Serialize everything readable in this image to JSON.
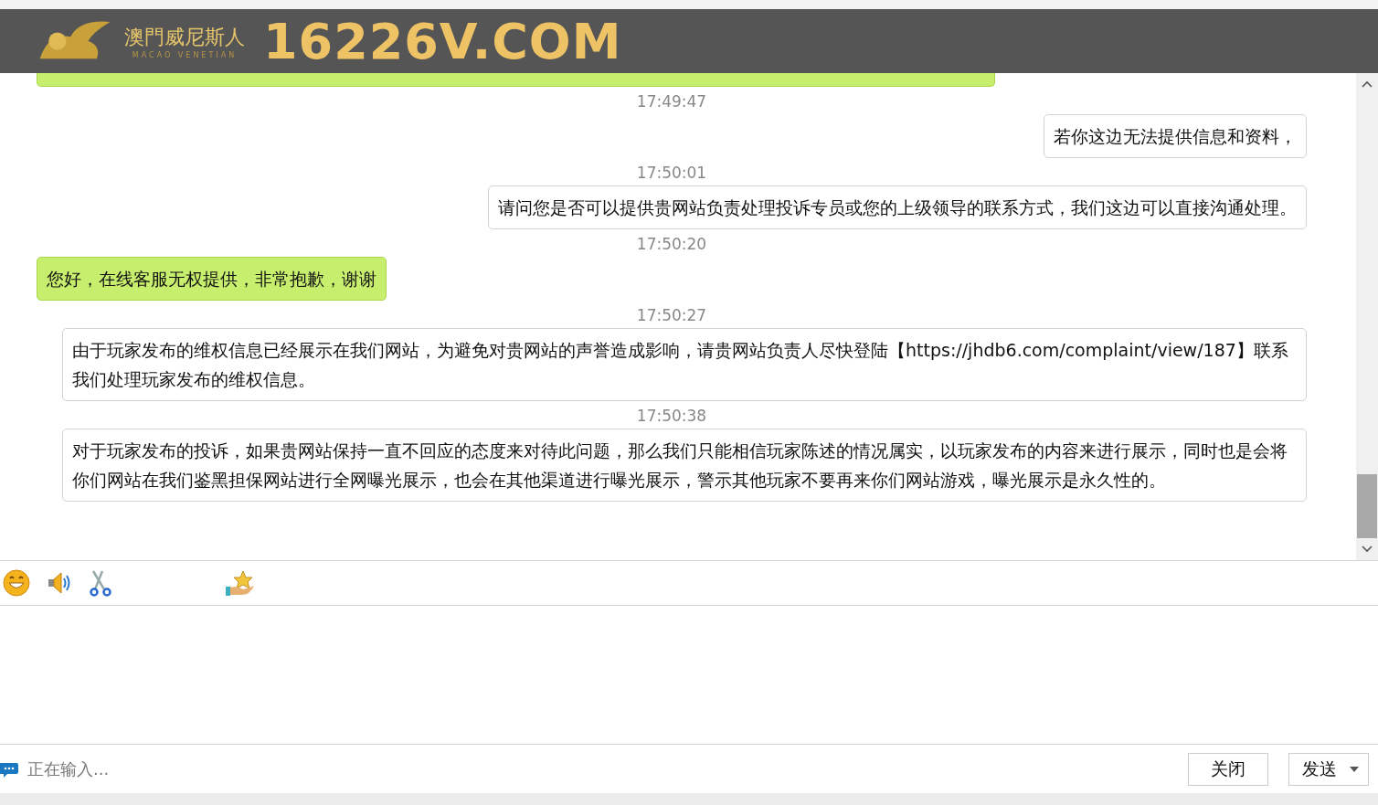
{
  "header": {
    "brand_cn": "澳門威尼斯人",
    "brand_en": "MACAO VENETIAN",
    "site": "16226V.COM"
  },
  "messages": [
    {
      "kind": "incoming_partial"
    },
    {
      "kind": "time",
      "text": "17:49:47"
    },
    {
      "kind": "outgoing",
      "text": "若你这边无法提供信息和资料，"
    },
    {
      "kind": "time",
      "text": "17:50:01"
    },
    {
      "kind": "outgoing",
      "text": "请问您是否可以提供贵网站负责处理投诉专员或您的上级领导的联系方式，我们这边可以直接沟通处理。"
    },
    {
      "kind": "time",
      "text": "17:50:20"
    },
    {
      "kind": "incoming",
      "text": "您好，在线客服无权提供，非常抱歉，谢谢"
    },
    {
      "kind": "time",
      "text": "17:50:27"
    },
    {
      "kind": "outgoing",
      "text": "由于玩家发布的维权信息已经展示在我们网站，为避免对贵网站的声誉造成影响，请贵网站负责人尽快登陆【https://jhdb6.com/complaint/view/187】联系我们处理玩家发布的维权信息。"
    },
    {
      "kind": "time",
      "text": "17:50:38"
    },
    {
      "kind": "outgoing",
      "text": "对于玩家发布的投诉，如果贵网站保持一直不回应的态度来对待此问题，那么我们只能相信玩家陈述的情况属实，以玩家发布的内容来进行展示，同时也是会将你们网站在我们鉴黑担保网站进行全网曝光展示，也会在其他渠道进行曝光展示，警示其他玩家不要再来你们网站游戏，曝光展示是永久性的。"
    }
  ],
  "status": "正在输入...",
  "buttons": {
    "close": "关闭",
    "send": "发送"
  }
}
